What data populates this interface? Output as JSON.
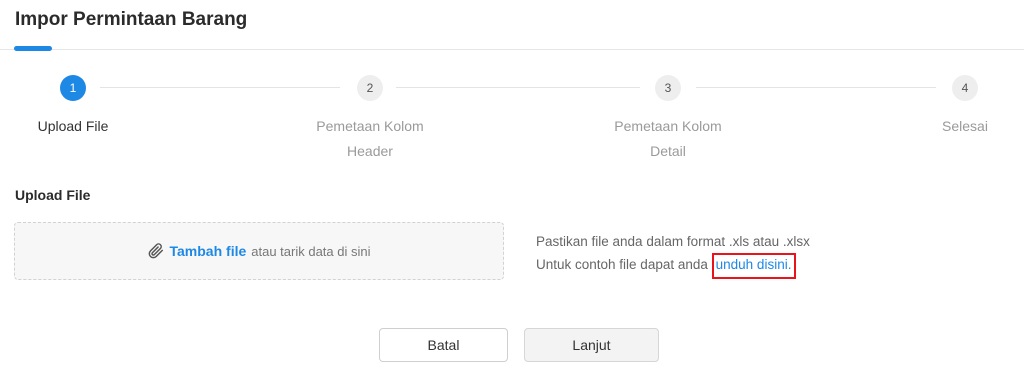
{
  "header": {
    "title": "Impor Permintaan Barang"
  },
  "stepper": {
    "steps": [
      {
        "number": "1",
        "label_line1": "Upload File",
        "label_line2": ""
      },
      {
        "number": "2",
        "label_line1": "Pemetaan Kolom",
        "label_line2": "Header"
      },
      {
        "number": "3",
        "label_line1": "Pemetaan Kolom",
        "label_line2": "Detail"
      },
      {
        "number": "4",
        "label_line1": "Selesai",
        "label_line2": ""
      }
    ],
    "active_step": 1
  },
  "upload": {
    "section_title": "Upload File",
    "add_file_label": "Tambah file",
    "drag_text": "atau tarik data di sini",
    "icon": "paperclip-icon"
  },
  "info": {
    "line1": "Pastikan file anda dalam format .xls atau .xlsx",
    "line2_prefix": "Untuk contoh file dapat anda ",
    "download_link": "unduh disini."
  },
  "buttons": {
    "cancel": "Batal",
    "next": "Lanjut"
  },
  "colors": {
    "accent": "#1e88e5",
    "highlight_border": "#e8131b"
  }
}
